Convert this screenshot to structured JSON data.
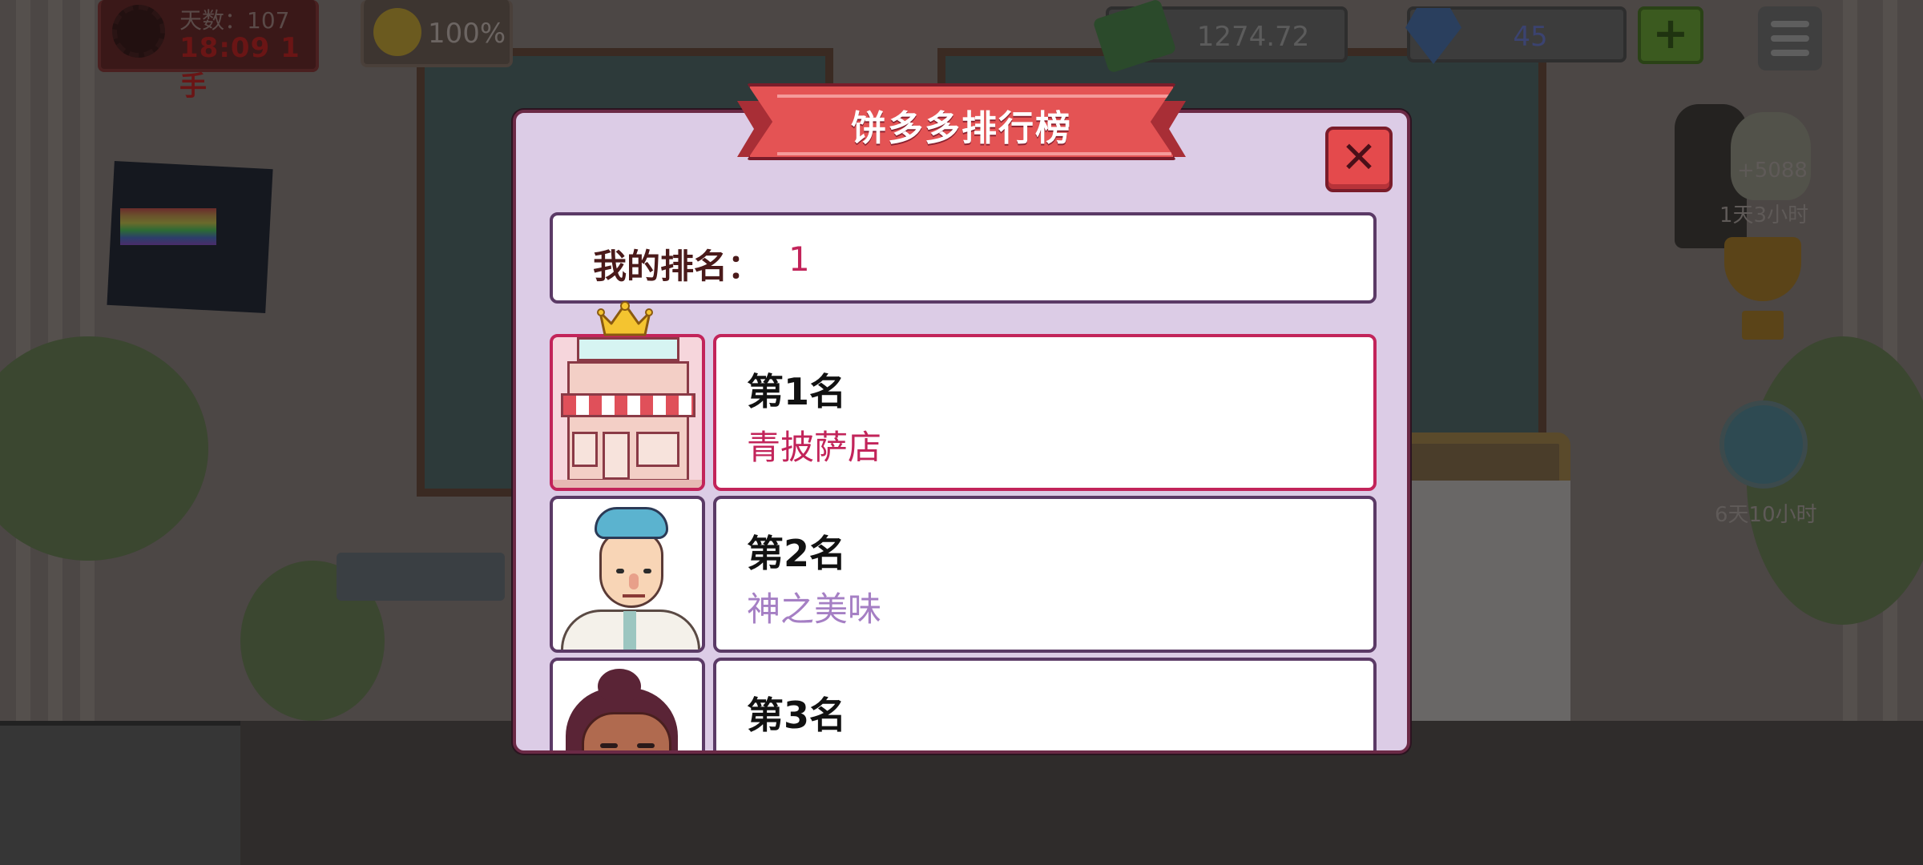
{
  "hud": {
    "day_label": "天数：107",
    "day_timer": "18:09 1手",
    "mood_percent": "100%",
    "money": "1274.72",
    "gems": "45",
    "add_label": "+"
  },
  "side": {
    "jar_bonus": "+5088",
    "jar_timer": "1天3小时",
    "globe_timer": "6天10小时"
  },
  "modal": {
    "title": "饼多多排行榜",
    "close_label": "✕",
    "my_rank_label": "我的排名：",
    "my_rank_value": "1"
  },
  "ranking": [
    {
      "position": "第1名",
      "name": "青披萨店"
    },
    {
      "position": "第2名",
      "name": "神之美味"
    },
    {
      "position": "第3名",
      "name": ""
    }
  ],
  "colors": {
    "modal_bg": "#dccce6",
    "banner": "#e45354",
    "highlight": "#c2245a",
    "secondary_name": "#a57fc4"
  },
  "icons": {
    "crown": "crown-icon",
    "close": "close-icon",
    "money": "money-icon",
    "gem": "gem-icon",
    "menu": "menu-icon"
  }
}
